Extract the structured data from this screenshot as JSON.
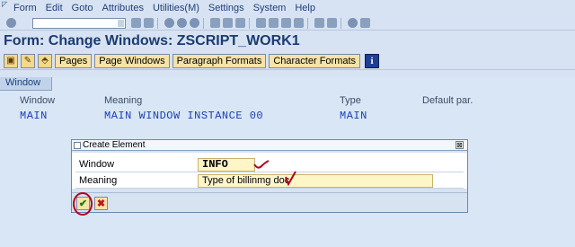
{
  "menu": {
    "items": [
      "Form",
      "Edit",
      "Goto",
      "Attributes",
      "Utilities(M)",
      "Settings",
      "System",
      "Help"
    ]
  },
  "title": "Form: Change Windows: ZSCRIPT_WORK1",
  "app_toolbar": {
    "buttons": [
      "Pages",
      "Page Windows",
      "Paragraph Formats",
      "Character Formats"
    ],
    "info_label": "i"
  },
  "window_tab": "Window",
  "table": {
    "headers": [
      "Window",
      "Meaning",
      "Type",
      "Default par."
    ],
    "row": {
      "window": "MAIN",
      "meaning": "MAIN WINDOW INSTANCE 00",
      "type": "MAIN"
    }
  },
  "dialog": {
    "title": "Create Element",
    "close_glyph": "⊠",
    "fields": [
      {
        "label": "Window",
        "value": "INFO"
      },
      {
        "label": "Meaning",
        "value": "Type of billinmg doc"
      }
    ],
    "ok_glyph": "✔",
    "cancel_glyph": "✖"
  },
  "colors": {
    "title_text": "#1c3b73",
    "value_text": "#1a3fb0",
    "annotation": "#b5001a"
  }
}
